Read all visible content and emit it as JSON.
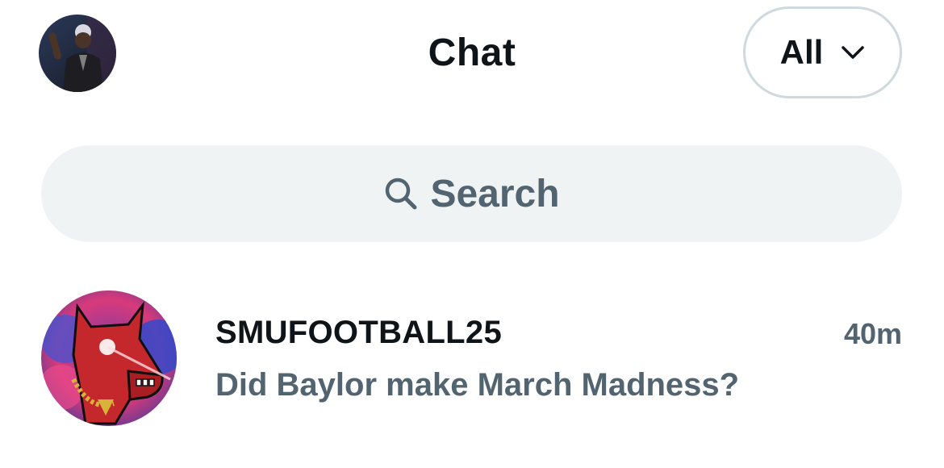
{
  "header": {
    "title": "Chat",
    "filter": {
      "label": "All",
      "icon": "chevron-down-icon"
    },
    "profile_avatar": "avatar"
  },
  "search": {
    "placeholder": "Search",
    "icon": "search-icon"
  },
  "conversations": [
    {
      "name": "SMUFOOTBALL25",
      "time": "40m",
      "preview": "Did Baylor make March Madness?"
    }
  ],
  "colors": {
    "primary_text": "#0f1419",
    "secondary_text": "#536471",
    "search_bg": "#eff3f4",
    "border": "#cfd9de",
    "background": "#ffffff"
  }
}
